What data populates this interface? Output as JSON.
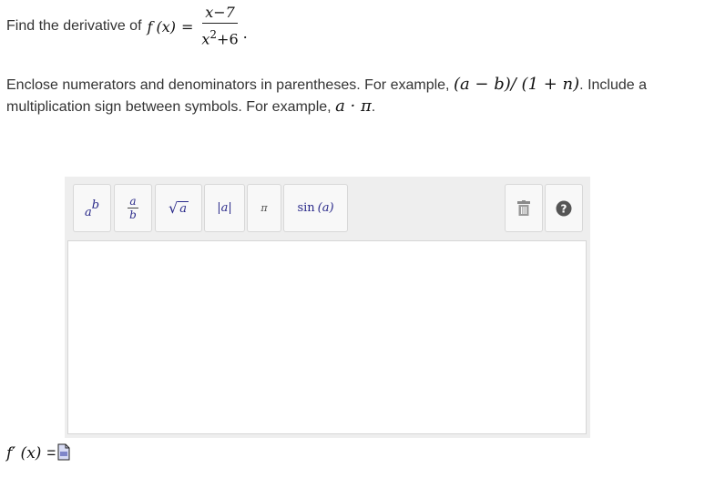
{
  "question": {
    "prefix": "Find the derivative of",
    "func": "f",
    "var": "(x)",
    "eq": "=",
    "numerator": "x−7",
    "den_base": "x",
    "den_exp": "2",
    "den_rest": "+6",
    "end": "."
  },
  "instructions": {
    "part1": "Enclose numerators and denominators in parentheses. For example,",
    "example1": "(a − b)/ (1 + n)",
    "part2": ". Include a multiplication sign between symbols. For example,",
    "example2": "a · π",
    "part3": "."
  },
  "toolbar": {
    "superscript": {
      "base": "a",
      "exp": "b"
    },
    "fraction": {
      "num": "a",
      "den": "b"
    },
    "sqrt": {
      "radicand": "a"
    },
    "abs": {
      "label": "|a|"
    },
    "pi": {
      "label": "π"
    },
    "sin": {
      "fn": "sin",
      "arg": "(a)"
    }
  },
  "answer": {
    "label": "f′ (x)",
    "eq": "="
  }
}
